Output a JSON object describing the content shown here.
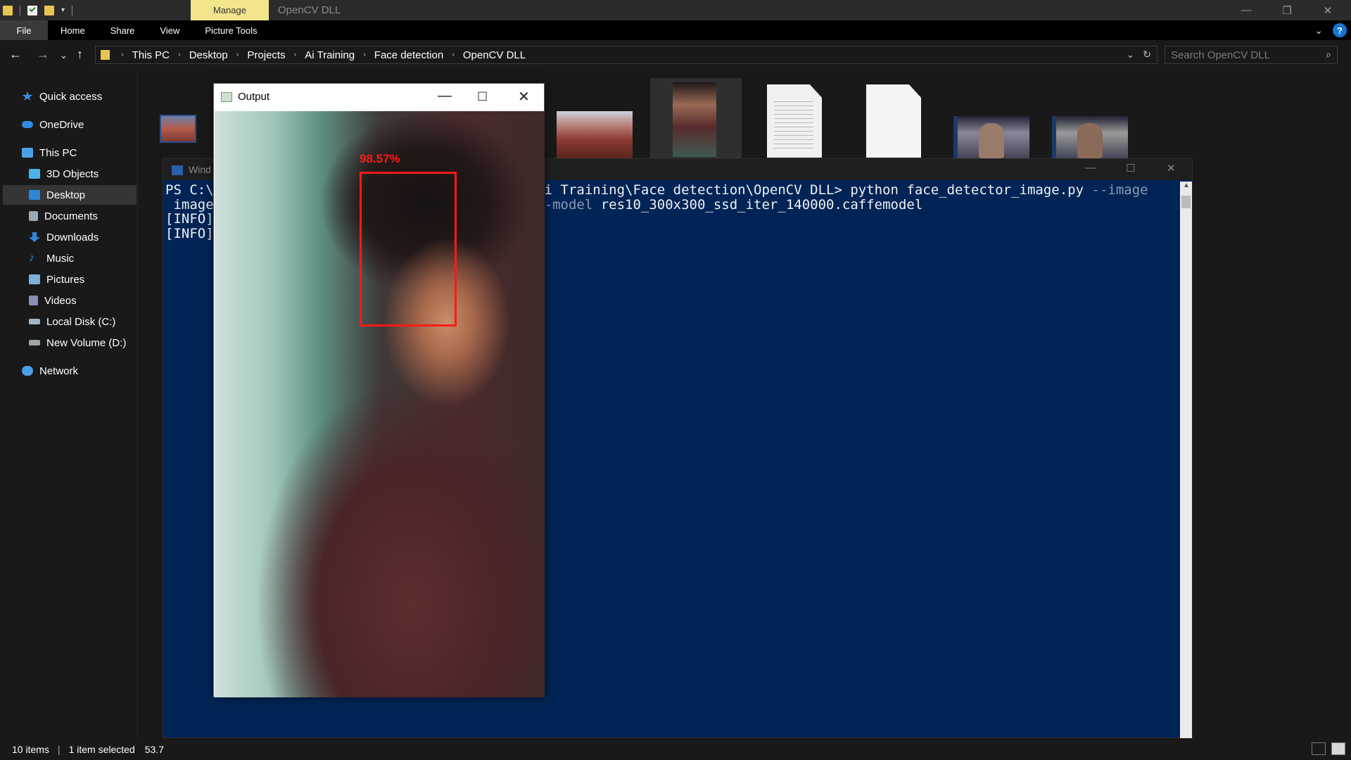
{
  "titlebar": {
    "manage_tab": "Manage",
    "title": "OpenCV DLL"
  },
  "ribbon": {
    "tabs": [
      "File",
      "Home",
      "Share",
      "View",
      "Picture Tools"
    ]
  },
  "address": {
    "crumbs": [
      "This PC",
      "Desktop",
      "Projects",
      "Ai Training",
      "Face detection",
      "OpenCV DLL"
    ],
    "search_placeholder": "Search OpenCV DLL"
  },
  "sidebar": {
    "items": [
      {
        "label": "Quick access",
        "icon": "star-icon",
        "color": "#3a8ee6"
      },
      {
        "label": "OneDrive",
        "icon": "cloud-icon",
        "color": "#2f8be0"
      },
      {
        "label": "This PC",
        "icon": "computer-icon",
        "color": "#4aa0e8"
      },
      {
        "label": "3D Objects",
        "icon": "cube-icon",
        "color": "#4bb3e8"
      },
      {
        "label": "Desktop",
        "icon": "desktop-icon",
        "color": "#2f86d6"
      },
      {
        "label": "Documents",
        "icon": "document-icon",
        "color": "#9aa7b5"
      },
      {
        "label": "Downloads",
        "icon": "download-icon",
        "color": "#2f86d6"
      },
      {
        "label": "Music",
        "icon": "music-icon",
        "color": "#2f86d6"
      },
      {
        "label": "Pictures",
        "icon": "pictures-icon",
        "color": "#7fb0d8"
      },
      {
        "label": "Videos",
        "icon": "videos-icon",
        "color": "#8a8fb5"
      },
      {
        "label": "Local Disk (C:)",
        "icon": "disk-icon",
        "color": "#9fb6c8"
      },
      {
        "label": "New Volume (D:)",
        "icon": "disk-icon",
        "color": "#9fa6ac"
      },
      {
        "label": "Network",
        "icon": "network-icon",
        "color": "#4aa0e8"
      }
    ],
    "selected": "Desktop"
  },
  "powershell": {
    "title": "Wind",
    "line1_a": "PS C:\\",
    "line1_b": "i Training\\Face detection\\OpenCV DLL> python face_detector_image.py ",
    "line1_c": "--image",
    "line2_a": " image",
    "line2_b": "-model ",
    "line2_c": "res10_300x300_ssd_iter_140000.caffemodel",
    "line3": "[INFO]",
    "line4": "[INFO]"
  },
  "output_window": {
    "title": "Output",
    "detection_label": "98.57%"
  },
  "status": {
    "items_count": "10 items",
    "selected": "1 item selected",
    "size": "53.7"
  }
}
